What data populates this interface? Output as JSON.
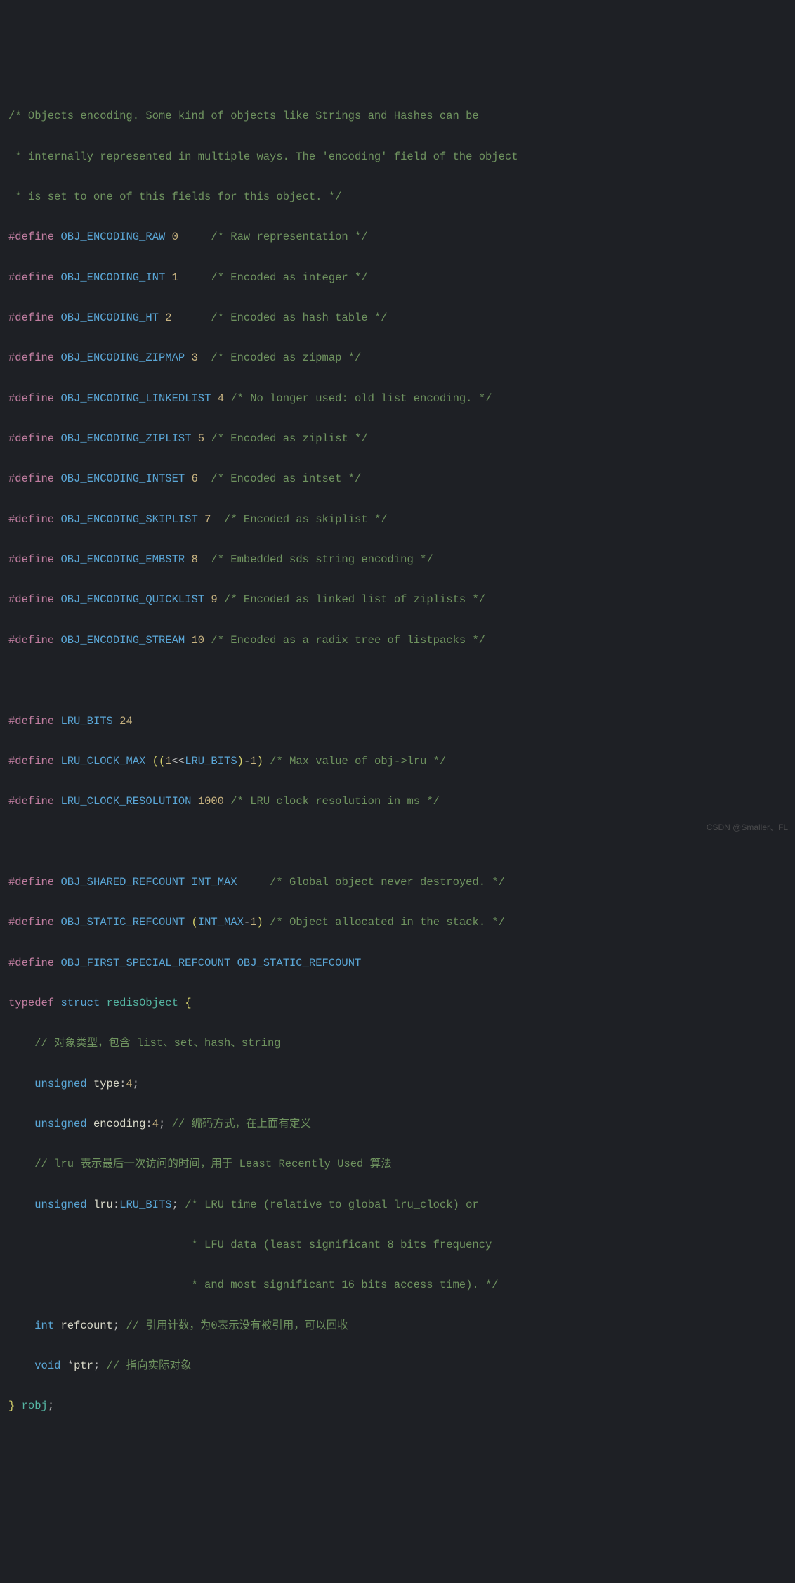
{
  "lines": {
    "c1": "/* Objects encoding. Some kind of objects like Strings and Hashes can be",
    "c2": " * internally represented in multiple ways. The 'encoding' field of the object",
    "c3": " * is set to one of this fields for this object. */",
    "d_raw_kw": "#define",
    "d_raw_m": "OBJ_ENCODING_RAW",
    "d_raw_n": "0",
    "d_raw_c": "/* Raw representation */",
    "d_int_kw": "#define",
    "d_int_m": "OBJ_ENCODING_INT",
    "d_int_n": "1",
    "d_int_c": "/* Encoded as integer */",
    "d_ht_kw": "#define",
    "d_ht_m": "OBJ_ENCODING_HT",
    "d_ht_n": "2",
    "d_ht_c": "/* Encoded as hash table */",
    "d_zm_kw": "#define",
    "d_zm_m": "OBJ_ENCODING_ZIPMAP",
    "d_zm_n": "3",
    "d_zm_c": "/* Encoded as zipmap */",
    "d_ll_kw": "#define",
    "d_ll_m": "OBJ_ENCODING_LINKEDLIST",
    "d_ll_n": "4",
    "d_ll_c": "/* No longer used: old list encoding. */",
    "d_zl_kw": "#define",
    "d_zl_m": "OBJ_ENCODING_ZIPLIST",
    "d_zl_n": "5",
    "d_zl_c": "/* Encoded as ziplist */",
    "d_is_kw": "#define",
    "d_is_m": "OBJ_ENCODING_INTSET",
    "d_is_n": "6",
    "d_is_c": "/* Encoded as intset */",
    "d_sl_kw": "#define",
    "d_sl_m": "OBJ_ENCODING_SKIPLIST",
    "d_sl_n": "7",
    "d_sl_c": "/* Encoded as skiplist */",
    "d_em_kw": "#define",
    "d_em_m": "OBJ_ENCODING_EMBSTR",
    "d_em_n": "8",
    "d_em_c": "/* Embedded sds string encoding */",
    "d_ql_kw": "#define",
    "d_ql_m": "OBJ_ENCODING_QUICKLIST",
    "d_ql_n": "9",
    "d_ql_c": "/* Encoded as linked list of ziplists */",
    "d_st_kw": "#define",
    "d_st_m": "OBJ_ENCODING_STREAM",
    "d_st_n": "10",
    "d_st_c": "/* Encoded as a radix tree of listpacks */",
    "d_lb_kw": "#define",
    "d_lb_m": "LRU_BITS",
    "d_lb_n": "24",
    "d_lc_kw": "#define",
    "d_lc_m": "LRU_CLOCK_MAX",
    "d_lc_lp": "((",
    "d_lc_1": "1",
    "d_lc_sh": "<<",
    "d_lc_mb": "LRU_BITS",
    "d_lc_rp": ")",
    "d_lc_mn": "-",
    "d_lc_12": "1",
    "d_lc_rp2": ")",
    "d_lc_c": "/* Max value of obj->lru */",
    "d_lr_kw": "#define",
    "d_lr_m": "LRU_CLOCK_RESOLUTION",
    "d_lr_n": "1000",
    "d_lr_c": "/* LRU clock resolution in ms */",
    "d_sr_kw": "#define",
    "d_sr_m": "OBJ_SHARED_REFCOUNT",
    "d_sr_v": "INT_MAX",
    "d_sr_c": "/* Global object never destroyed. */",
    "d_str_kw": "#define",
    "d_str_m": "OBJ_STATIC_REFCOUNT",
    "d_str_lp": "(",
    "d_str_v": "INT_MAX",
    "d_str_mn": "-",
    "d_str_1": "1",
    "d_str_rp": ")",
    "d_str_c": "/* Object allocated in the stack. */",
    "d_fr_kw": "#define",
    "d_fr_m": "OBJ_FIRST_SPECIAL_REFCOUNT",
    "d_fr_v": "OBJ_STATIC_REFCOUNT",
    "td_kw": "typedef",
    "td_st": "struct",
    "td_nm": "redisObject",
    "td_lb": "{",
    "s_c1": "// 对象类型，包含 list、set、hash、string",
    "s_u1": "unsigned",
    "s_f1": "type",
    "s_col1": ":",
    "s_n1": "4",
    "s_sc1": ";",
    "s_u2": "unsigned",
    "s_f2": "encoding",
    "s_col2": ":",
    "s_n2": "4",
    "s_sc2": ";",
    "s_c2": "// 编码方式，在上面有定义",
    "s_c3": "// lru 表示最后一次访问的时间，用于 Least Recently Used 算法",
    "s_u3": "unsigned",
    "s_f3": "lru",
    "s_col3": ":",
    "s_m3": "LRU_BITS",
    "s_sc3": ";",
    "s_c3a": "/* LRU time (relative to global lru_clock) or",
    "s_c3b": "                            * LFU data (least significant 8 bits frequency",
    "s_c3c": "                            * and most significant 16 bits access time). */",
    "s_int": "int",
    "s_f4": "refcount",
    "s_sc4": ";",
    "s_c4": "// 引用计数，为0表示没有被引用，可以回收",
    "s_void": "void",
    "s_star": "*",
    "s_f5": "ptr",
    "s_sc5": ";",
    "s_c5": "// 指向实际对象",
    "td_rb": "}",
    "td_alias": "robj",
    "td_sc": ";"
  },
  "watermark": "CSDN @Smaller、FL"
}
